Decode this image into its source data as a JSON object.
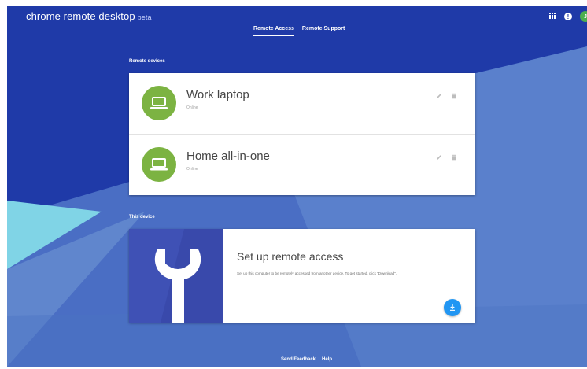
{
  "header": {
    "app_title": "chrome remote desktop",
    "beta_label": "beta",
    "tabs": [
      {
        "label": "Remote Access",
        "active": true
      },
      {
        "label": "Remote Support",
        "active": false
      }
    ],
    "apps_icon": "apps-grid-icon",
    "help_icon_glyph": "!",
    "avatar_letter": "J"
  },
  "remote_devices": {
    "section_label": "Remote devices",
    "devices": [
      {
        "name": "Work laptop",
        "status": "Online",
        "icon": "laptop-icon"
      },
      {
        "name": "Home all-in-one",
        "status": "Online",
        "icon": "laptop-icon"
      }
    ]
  },
  "this_device": {
    "section_label": "This device",
    "title": "Set up remote access",
    "description": "Set up this computer to be remotely accessed from another device. To get started, click \"Download\".",
    "art_icon": "wrench-icon",
    "download_icon": "download-icon"
  },
  "footer": {
    "feedback_label": "Send Feedback",
    "help_label": "Help"
  },
  "colors": {
    "background_dark": "#1f3aa8",
    "background_light": "#5276c4",
    "background_teal": "#7fd0e6",
    "device_avatar": "#7cb342",
    "setup_art": "#3f51b5",
    "download_button": "#2196f3"
  }
}
